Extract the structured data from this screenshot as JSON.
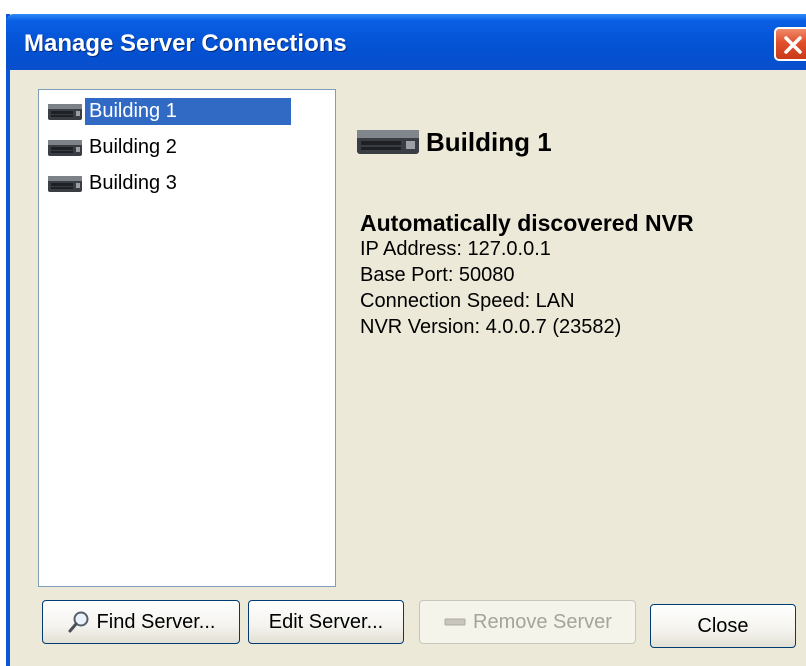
{
  "window": {
    "title": "Manage Server Connections"
  },
  "servers": [
    {
      "label": "Building 1",
      "selected": true
    },
    {
      "label": "Building 2",
      "selected": false
    },
    {
      "label": "Building 3",
      "selected": false
    }
  ],
  "details": {
    "name": "Building 1",
    "kind": "Automatically discovered NVR",
    "lines": [
      "IP Address: 127.0.0.1",
      "Base Port: 50080",
      "Connection Speed: LAN",
      "NVR Version: 4.0.0.7 (23582)"
    ]
  },
  "buttons": {
    "find": "Find Server...",
    "edit": "Edit Server...",
    "remove": "Remove Server",
    "close": "Close"
  },
  "icons": {
    "title_close": "close-icon",
    "server": "server-icon",
    "find": "magnifier-icon",
    "remove": "minus-icon"
  },
  "colors": {
    "titlebar": "#0555d8",
    "selection": "#316ac5",
    "dialog_bg": "#ece9d8"
  }
}
